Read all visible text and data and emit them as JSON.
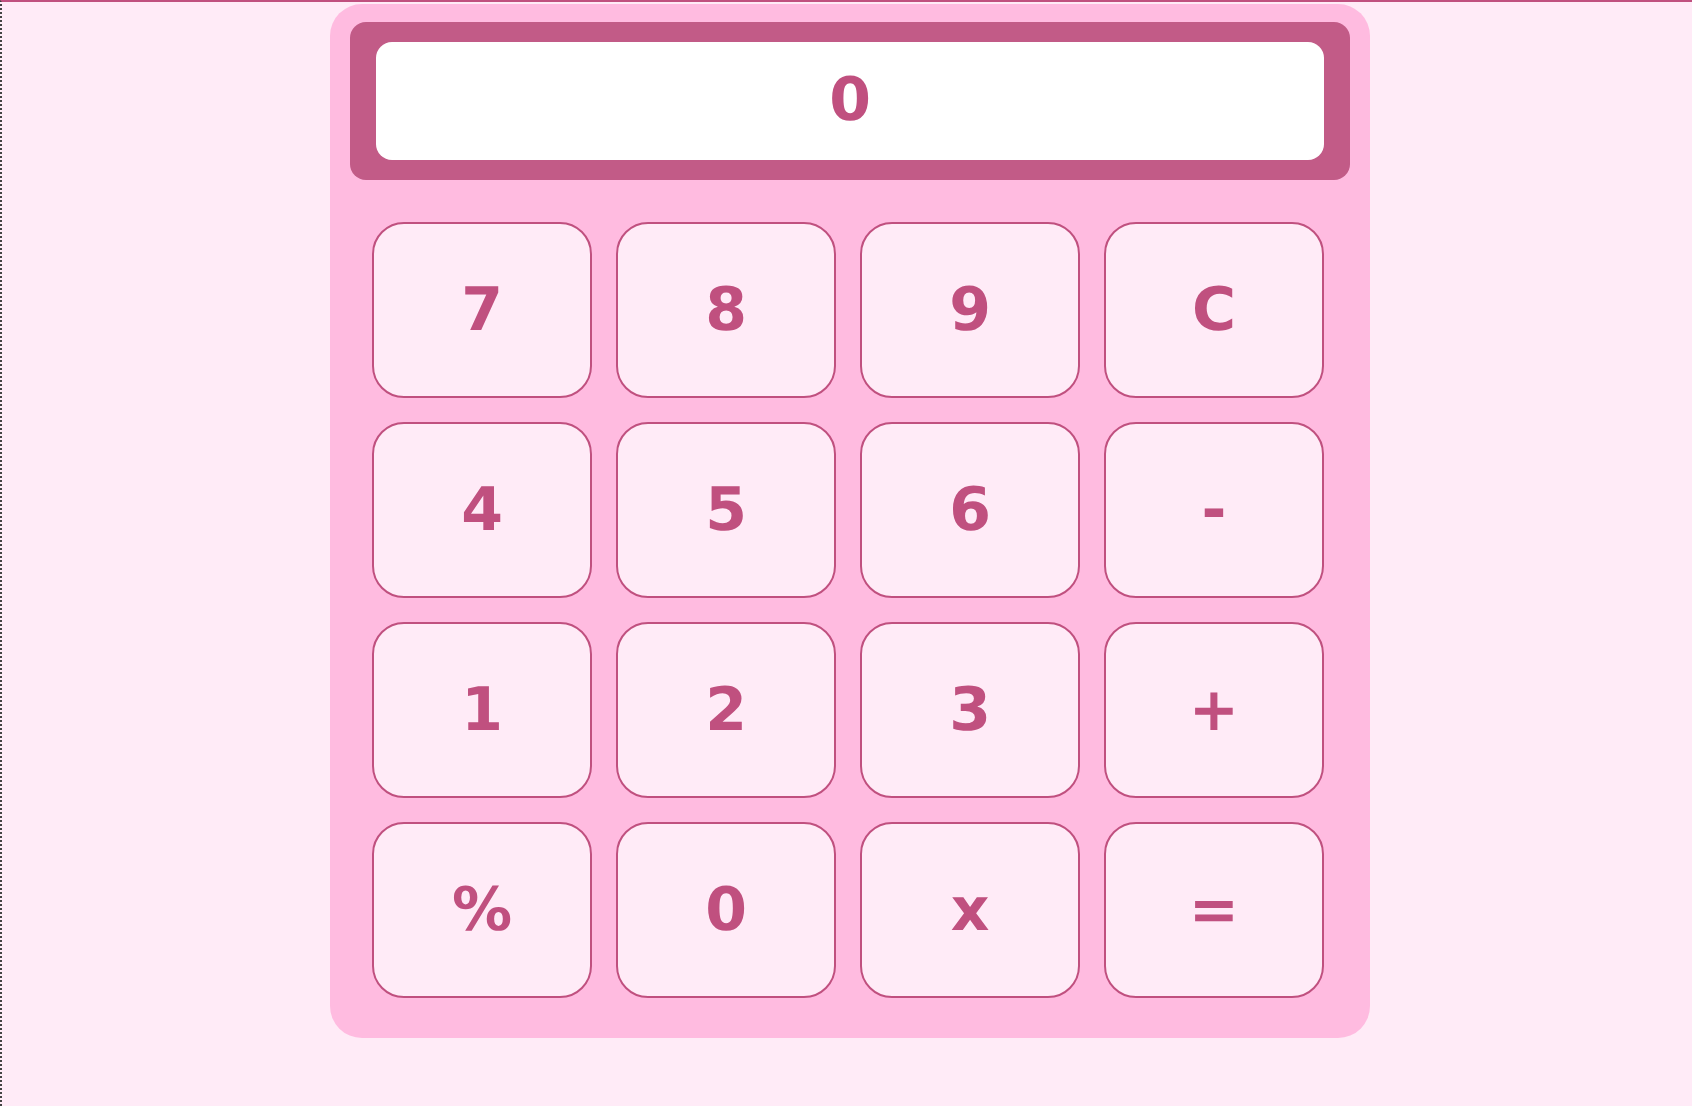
{
  "display": {
    "value": "0"
  },
  "keys": [
    {
      "label": "7"
    },
    {
      "label": "8"
    },
    {
      "label": "9"
    },
    {
      "label": "C"
    },
    {
      "label": "4"
    },
    {
      "label": "5"
    },
    {
      "label": "6"
    },
    {
      "label": "-"
    },
    {
      "label": "1"
    },
    {
      "label": "2"
    },
    {
      "label": "3"
    },
    {
      "label": "+"
    },
    {
      "label": "%"
    },
    {
      "label": "0"
    },
    {
      "label": "x"
    },
    {
      "label": "="
    }
  ]
}
